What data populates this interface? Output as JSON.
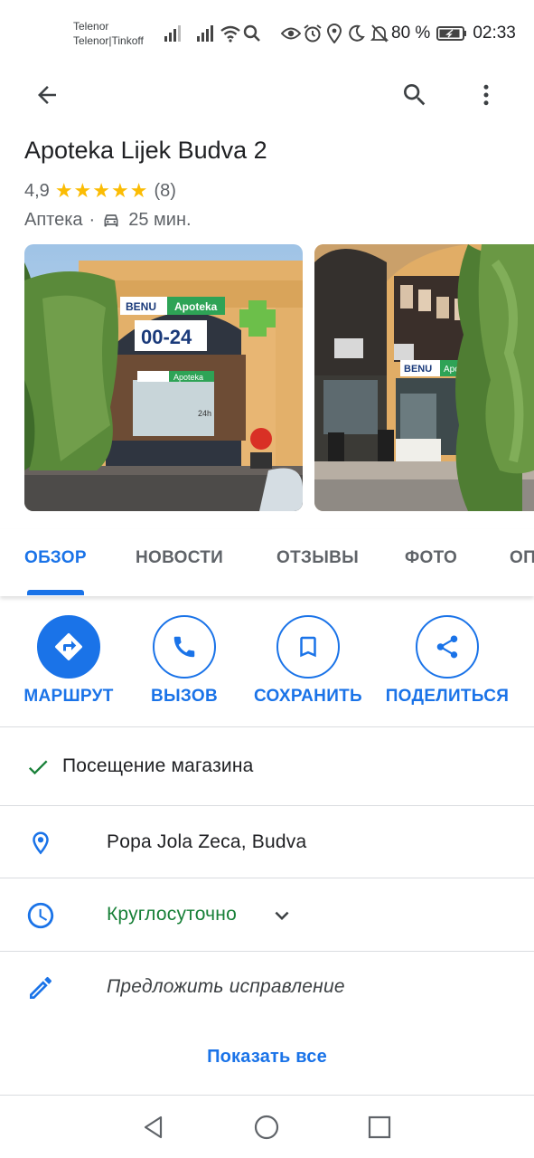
{
  "status_bar": {
    "carrier_1": "Telenor",
    "carrier_2": "Telenor|Tinkoff",
    "battery": "80 %",
    "time": "02:33"
  },
  "appbar": {
    "back_icon": "arrow-left-icon",
    "search_icon": "search-icon",
    "more_icon": "more-vert-icon"
  },
  "place": {
    "title": "Apoteka Lijek Budva 2",
    "rating": "4,9",
    "stars": 5,
    "reviews": "(8)",
    "category": "Аптека",
    "separator": "·",
    "travel_time": "25 мин."
  },
  "tabs": [
    {
      "label": "ОБЗОР",
      "active": true
    },
    {
      "label": "НОВОСТИ",
      "active": false
    },
    {
      "label": "ОТЗЫВЫ",
      "active": false
    },
    {
      "label": "ФОТО",
      "active": false
    },
    {
      "label": "ОП",
      "active": false
    }
  ],
  "actions": [
    {
      "label": "МАРШРУТ",
      "icon": "directions-icon"
    },
    {
      "label": "ВЫЗОВ",
      "icon": "phone-icon"
    },
    {
      "label": "СОХРАНИТЬ",
      "icon": "bookmark-icon"
    },
    {
      "label": "ПОДЕЛИТЬСЯ",
      "icon": "share-icon"
    }
  ],
  "details": {
    "instore": "Посещение магазина",
    "address": "Popa Jola Zeca, Budva",
    "hours": "Круглосуточно",
    "suggest_edit": "Предложить исправление",
    "show_all": "Показать все"
  },
  "photo_1": {
    "sign_brand": "BENU",
    "sign_name": "Apoteka",
    "sign_hours": "00-24",
    "small_sign": "Apoteka",
    "small_hours": "24h"
  },
  "photo_2": {
    "sign_brand": "BENU",
    "sign_name": "Apoteka"
  },
  "colors": {
    "accent": "#1a73e8",
    "open_green": "#188038",
    "star": "#fbbc04",
    "pharmacy_green": "#2ea356"
  }
}
